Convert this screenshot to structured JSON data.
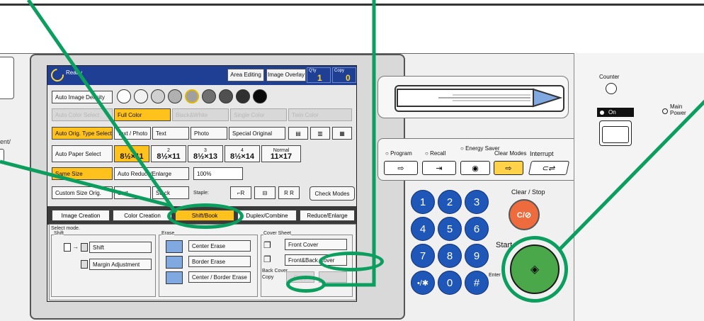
{
  "screen": {
    "status": "Ready",
    "header_buttons": [
      "Area Editing",
      "Image Overlay"
    ],
    "qty_label": "Q'ty",
    "qty_value": "1",
    "copy_label": "Copy",
    "copy_value": "0"
  },
  "rows": {
    "density_label": "Auto Image Density",
    "color_modes": [
      "Auto Color Select",
      "Full Color",
      "Black&White",
      "Single Color",
      "Twin Color"
    ],
    "orig_type": [
      "Auto Orig. Type Select",
      "Text / Photo",
      "Text",
      "Photo",
      "Special Original"
    ],
    "auto_paper": "Auto Paper Select",
    "trays": [
      {
        "num": "1",
        "size": "8½×11"
      },
      {
        "num": "2",
        "size": "8½×11"
      },
      {
        "num": "3",
        "size": "8½×13"
      },
      {
        "num": "4",
        "size": "8½×14"
      }
    ],
    "normal_label": "Normal",
    "normal_size": "11×17",
    "ratio_row": [
      "Same Size",
      "Auto Reduce/Enlarge",
      "100%"
    ],
    "finish_row": [
      "Custom Size Orig.",
      "Sort",
      "Stack",
      "Staple:"
    ],
    "check_modes": "Check Modes"
  },
  "tabs": [
    "Image Creation",
    "Color Creation",
    "Shift/Book",
    "Duplex/Combine",
    "Reduce/Enlarge"
  ],
  "lower": {
    "prompt": "Select mode.",
    "shift_title": "Shift",
    "shift_buttons": [
      "Shift",
      "Margin Adjustment"
    ],
    "erase_title": "Erase",
    "erase_buttons": [
      "Center Erase",
      "Border Erase",
      "Center / Border Erase"
    ],
    "cover_title": "Cover Sheet",
    "cover_buttons": [
      "Front Cover",
      "Front&Back Cover"
    ],
    "back_cover_label": "Back Cover",
    "copy_label": "Copy",
    "copy_btn": "Copy"
  },
  "panel": {
    "left_label": "ent/",
    "func_labels": [
      "Program",
      "Recall",
      "Energy Saver",
      "Clear Modes",
      "Interrupt"
    ],
    "keypad": [
      "1",
      "2",
      "3",
      "4",
      "5",
      "6",
      "7",
      "8",
      "9",
      "•/✱",
      "0",
      "#"
    ],
    "clear_stop_label": "Clear / Stop",
    "clear_btn": "C/⊘",
    "start_label": "Start",
    "enter_label": "Enter",
    "start_icon": "◈",
    "counter_label": "Counter",
    "on_label": "On",
    "main_power_label": "Main Power"
  },
  "colors": {
    "accent_yellow": "#ffc21c",
    "status_blue": "#1f3f95",
    "key_blue": "#1f57b8",
    "callout_green": "#0b9e5e",
    "start_green": "#4aa84a",
    "clear_orange": "#ee6b3d"
  }
}
